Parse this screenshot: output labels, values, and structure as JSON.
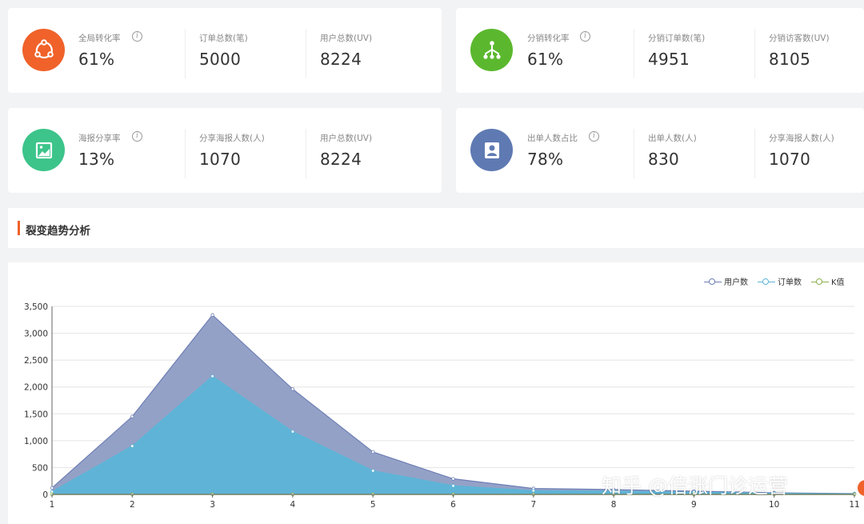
{
  "cards": [
    {
      "icon": "share-icon",
      "icon_color": "#f0622a",
      "stats": [
        {
          "label": "全局转化率",
          "value": "61%",
          "info": true
        },
        {
          "label": "订单总数(笔)",
          "value": "5000"
        },
        {
          "label": "用户总数(UV)",
          "value": "8224"
        }
      ]
    },
    {
      "icon": "distribution-icon",
      "icon_color": "#5bb82e",
      "stats": [
        {
          "label": "分销转化率",
          "value": "61%",
          "info": true
        },
        {
          "label": "分销订单数(笔)",
          "value": "4951"
        },
        {
          "label": "分销访客数(UV)",
          "value": "8105"
        }
      ]
    },
    {
      "icon": "poster-icon",
      "icon_color": "#3cc48a",
      "stats": [
        {
          "label": "海报分享率",
          "value": "13%",
          "info": true
        },
        {
          "label": "分享海报人数(人)",
          "value": "1070"
        },
        {
          "label": "用户总数(UV)",
          "value": "8224"
        }
      ]
    },
    {
      "icon": "user-icon",
      "icon_color": "#5f7ab3",
      "stats": [
        {
          "label": "出单人数占比",
          "value": "78%",
          "info": true
        },
        {
          "label": "出单人数(人)",
          "value": "830"
        },
        {
          "label": "分享海报人数(人)",
          "value": "1070"
        }
      ]
    }
  ],
  "section": {
    "title": "裂变趋势分析"
  },
  "chart_data": {
    "type": "area",
    "x": [
      1,
      2,
      3,
      4,
      5,
      6,
      7,
      8,
      9,
      10,
      11
    ],
    "ylim": [
      0,
      3500
    ],
    "yticks": [
      "0",
      "500",
      "1,000",
      "1,500",
      "2,000",
      "2,500",
      "3,000",
      "3,500"
    ],
    "xticks": [
      "1",
      "2",
      "3",
      "4",
      "5",
      "6",
      "7",
      "8",
      "9",
      "10",
      "11"
    ],
    "legend_position": "top-right",
    "grid": true,
    "series": [
      {
        "name": "用户数",
        "color": "#6e7fb5",
        "fill": "#8e9cc4",
        "values": [
          120,
          1450,
          3340,
          1960,
          790,
          290,
          110,
          90,
          60,
          30,
          15
        ]
      },
      {
        "name": "订单数",
        "color": "#5bb6d6",
        "fill": "#5ab4d8",
        "values": [
          50,
          900,
          2200,
          1170,
          440,
          160,
          70,
          60,
          40,
          20,
          10
        ]
      },
      {
        "name": "K值",
        "color": "#8bb04e",
        "fill": "none",
        "values": [
          0,
          0,
          0,
          0,
          0,
          0,
          0,
          0,
          0,
          0,
          0
        ]
      }
    ]
  },
  "watermark": "知乎 @倍涨门诊运营"
}
